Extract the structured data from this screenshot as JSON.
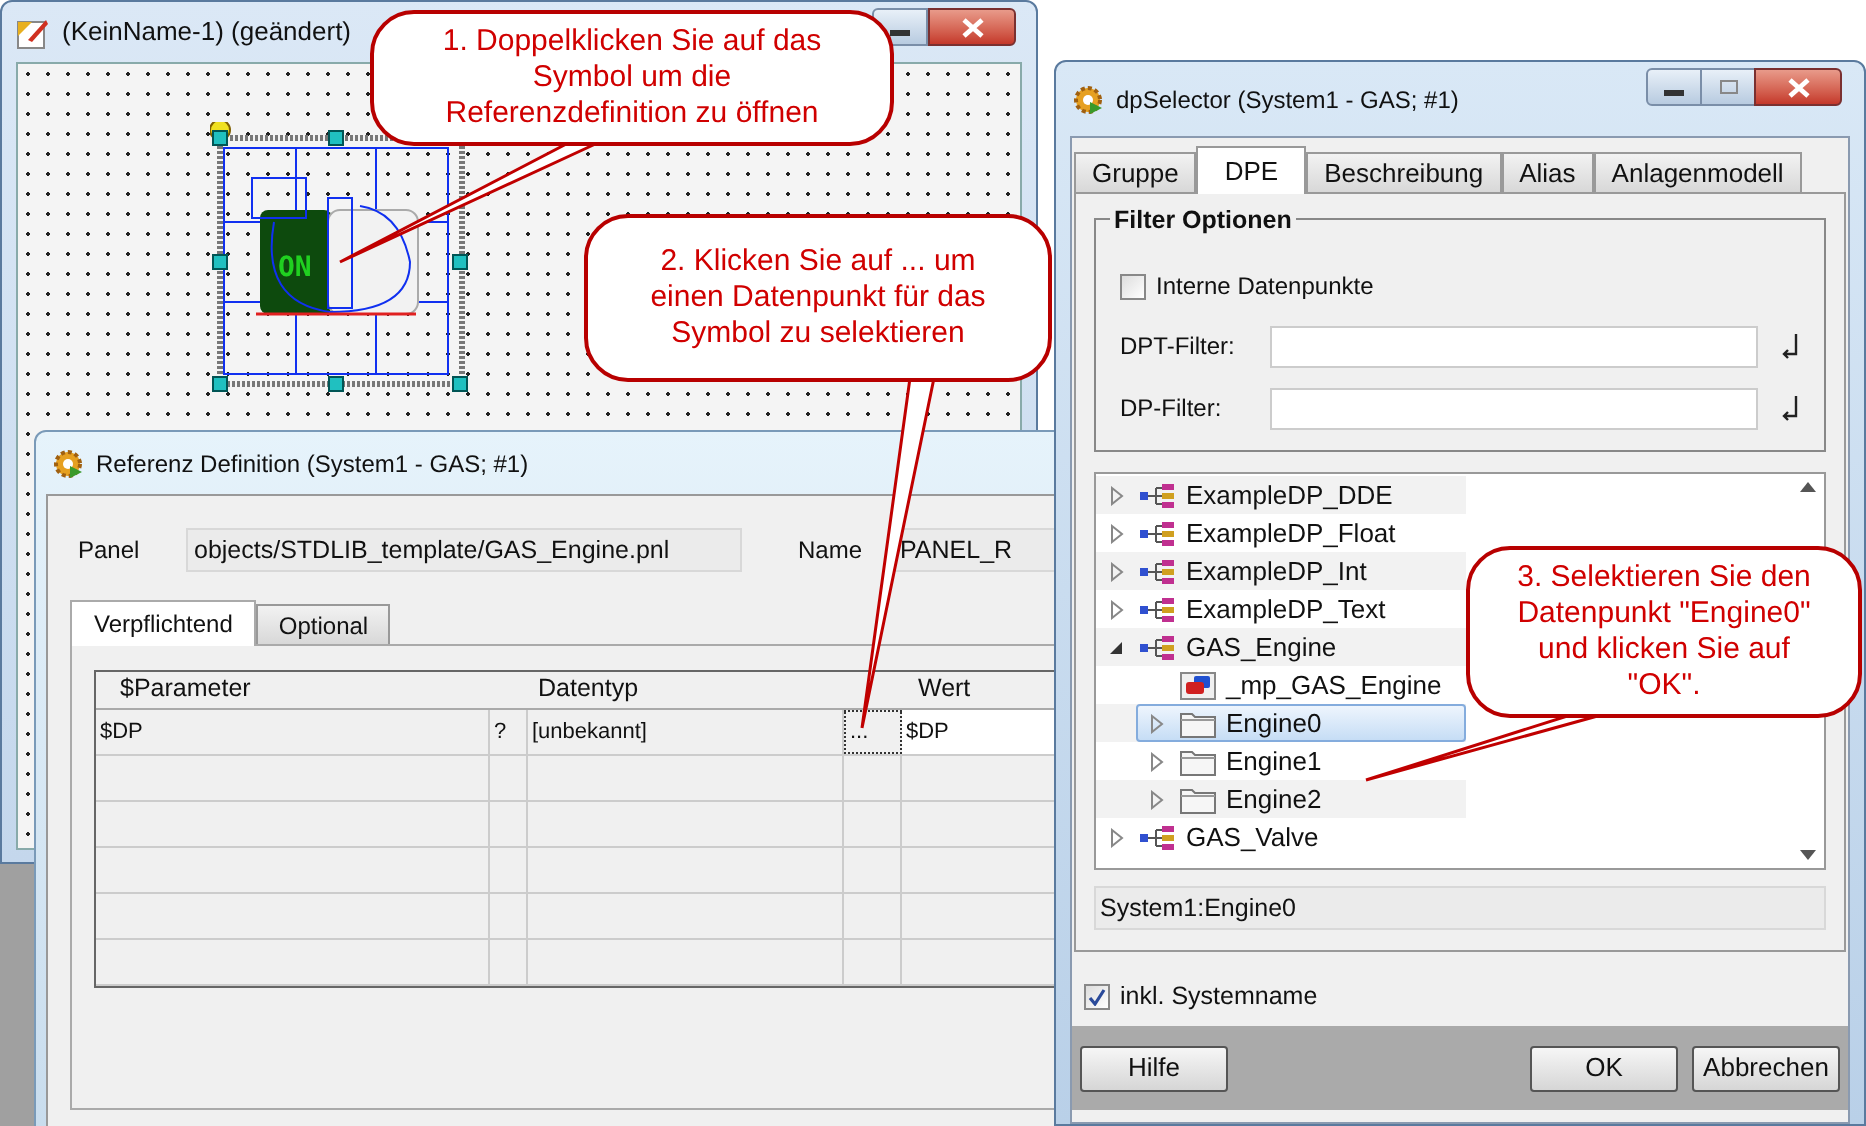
{
  "editor_window": {
    "title": "(KeinName-1) (geändert)",
    "symbol": {
      "label": "ON"
    }
  },
  "reference_dialog": {
    "title": "Referenz Definition (System1 - GAS; #1)",
    "panel_label": "Panel",
    "panel_value": "objects/STDLIB_template/GAS_Engine.pnl",
    "name_label": "Name",
    "name_value": "PANEL_R",
    "tabs": [
      {
        "label": "Verpflichtend",
        "selected": true
      },
      {
        "label": "Optional",
        "selected": false
      }
    ],
    "table": {
      "columns": [
        "$Parameter",
        "Datentyp",
        "Wert"
      ],
      "rows": [
        {
          "parameter": "$DP",
          "flag": "?",
          "type": "[unbekannt]",
          "action": "...",
          "value": "$DP"
        }
      ]
    }
  },
  "dp_selector": {
    "title": "dpSelector (System1 - GAS; #1)",
    "tabs": [
      {
        "label": "Gruppe",
        "selected": false
      },
      {
        "label": "DPE",
        "selected": true
      },
      {
        "label": "Beschreibung",
        "selected": false
      },
      {
        "label": "Alias",
        "selected": false
      },
      {
        "label": "Anlagenmodell",
        "selected": false
      }
    ],
    "group_title": "Filter Optionen",
    "internal_checkbox": {
      "label": "Interne Datenpunkte",
      "checked": false
    },
    "filters": [
      {
        "label": "DPT-Filter:"
      },
      {
        "label": "DP-Filter:"
      }
    ],
    "tree": [
      {
        "label": "ExampleDP_DDE",
        "kind": "datapoint",
        "expanded": false,
        "selected": false
      },
      {
        "label": "ExampleDP_Float",
        "kind": "datapoint",
        "expanded": false,
        "selected": false
      },
      {
        "label": "ExampleDP_Int",
        "kind": "datapoint",
        "expanded": false,
        "selected": false
      },
      {
        "label": "ExampleDP_Text",
        "kind": "datapoint",
        "expanded": false,
        "selected": false
      },
      {
        "label": "GAS_Engine",
        "kind": "datapoint",
        "expanded": true,
        "selected": false,
        "children": [
          {
            "label": "_mp_GAS_Engine",
            "kind": "master",
            "selected": false
          },
          {
            "label": "Engine0",
            "kind": "folder",
            "expanded": false,
            "selected": true
          },
          {
            "label": "Engine1",
            "kind": "folder",
            "expanded": false,
            "selected": false
          },
          {
            "label": "Engine2",
            "kind": "folder",
            "expanded": false,
            "selected": false
          }
        ]
      },
      {
        "label": "GAS_Valve",
        "kind": "datapoint",
        "expanded": false,
        "selected": false
      }
    ],
    "selection": "System1:Engine0",
    "system_checkbox": {
      "label": "inkl. Systemname",
      "checked": true
    },
    "buttons": [
      "Hilfe",
      "OK",
      "Abbrechen"
    ]
  },
  "callouts": [
    {
      "text": "1. Doppelklicken Sie auf das Symbol um die Referenzdefinition zu öffnen"
    },
    {
      "text": "2. Klicken Sie auf ... um einen Datenpunkt für das Symbol zu selektieren"
    },
    {
      "text": "3. Selektieren Sie den Datenpunkt \"Engine0\" und klicken Sie auf \"OK\"."
    }
  ]
}
